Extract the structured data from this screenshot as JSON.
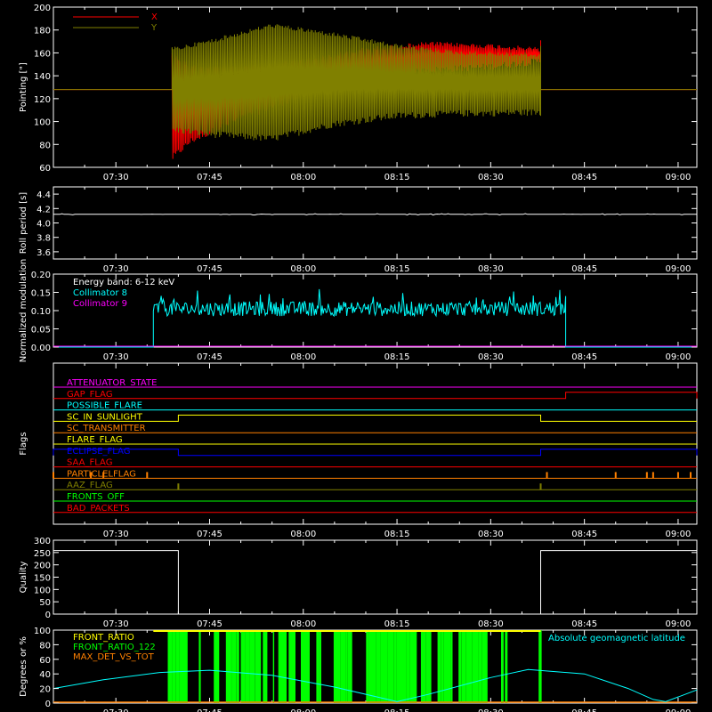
{
  "x_tick_labels": [
    "07:30",
    "07:45",
    "08:00",
    "08:15",
    "08:30",
    "08:45",
    "09:00"
  ],
  "chart_data": [
    {
      "type": "line",
      "ylabel": "Pointing [\"]",
      "ylim": [
        60,
        200
      ],
      "yticks": [
        "60",
        "80",
        "100",
        "120",
        "140",
        "160",
        "180",
        "200"
      ],
      "legend": [
        {
          "name": "X",
          "color": "#ff0000"
        },
        {
          "name": "Y",
          "color": "#808000"
        }
      ],
      "series": [
        {
          "name": "X",
          "color": "#ff0000",
          "baseline": 128,
          "active_start": "07:39",
          "active_end": "08:38",
          "envelope": [
            [
              "07:39",
              65,
              160
            ],
            [
              "07:42",
              80,
              150
            ],
            [
              "07:50",
              100,
              148
            ],
            [
              "08:00",
              120,
              155
            ],
            [
              "08:10",
              132,
              165
            ],
            [
              "08:20",
              142,
              170
            ],
            [
              "08:30",
              145,
              168
            ],
            [
              "08:38",
              150,
              165
            ]
          ]
        },
        {
          "name": "Y",
          "color": "#808000",
          "baseline": 128,
          "active_start": "07:39",
          "active_end": "08:38",
          "envelope": [
            [
              "07:39",
              90,
              165
            ],
            [
              "07:45",
              86,
              172
            ],
            [
              "07:55",
              82,
              186
            ],
            [
              "08:05",
              95,
              178
            ],
            [
              "08:15",
              102,
              168
            ],
            [
              "08:25",
              104,
              162
            ],
            [
              "08:38",
              105,
              160
            ]
          ]
        }
      ]
    },
    {
      "type": "line",
      "ylabel": "Roll period [s]",
      "ylim": [
        3.5,
        4.5
      ],
      "yticks": [
        "3.6",
        "3.8",
        "4.0",
        "4.2",
        "4.4"
      ],
      "series": [
        {
          "name": "roll",
          "color": "#ffffff",
          "value": 4.12
        }
      ]
    },
    {
      "type": "line",
      "ylabel": "Normalized modulation",
      "ylim": [
        0,
        0.2
      ],
      "yticks": [
        "0.00",
        "0.05",
        "0.10",
        "0.15",
        "0.20"
      ],
      "annotation": "Energy band: 6-12 keV",
      "legend": [
        {
          "name": "Collimator 8",
          "color": "#00ffff"
        },
        {
          "name": "Collimator 9",
          "color": "#ff00ff"
        }
      ],
      "series": [
        {
          "name": "Collimator 8",
          "color": "#00ffff",
          "active_start": "07:36",
          "active_end": "08:42",
          "mean": 0.105,
          "spread": 0.02
        },
        {
          "name": "Collimator 9",
          "color": "#ff00ff",
          "value": 0.0
        }
      ]
    },
    {
      "type": "line",
      "ylabel": "Flags",
      "flags": [
        {
          "name": "ATTENUATOR_STATE",
          "color": "#ff00ff",
          "on": []
        },
        {
          "name": "GAP_FLAG",
          "color": "#ff0000",
          "on": [
            [
              "08:42",
              "09:03"
            ]
          ]
        },
        {
          "name": "POSSIBLE_FLARE",
          "color": "#00ffff",
          "on": []
        },
        {
          "name": "SC_IN_SUNLIGHT",
          "color": "#ffff00",
          "on": [
            [
              "07:40",
              "08:38"
            ]
          ]
        },
        {
          "name": "SC_TRANSMITTER",
          "color": "#ff8000",
          "on": []
        },
        {
          "name": "FLARE_FLAG",
          "color": "#ffff00",
          "on": []
        },
        {
          "name": "ECLIPSE_FLAG",
          "color": "#0000ff",
          "on": [
            [
              "07:20",
              "07:40"
            ],
            [
              "08:38",
              "09:03"
            ]
          ]
        },
        {
          "name": "SAA_FLAG",
          "color": "#ff0000",
          "on": []
        },
        {
          "name": "PARTICLELFLAG",
          "color": "#ff8000",
          "spikes": [
            "07:20",
            "07:26",
            "07:28",
            "07:35",
            "08:39",
            "08:50",
            "08:55",
            "08:56",
            "09:00",
            "09:02"
          ]
        },
        {
          "name": "AAZ_FLAG",
          "color": "#808000",
          "spikes": [
            "07:40",
            "08:38"
          ]
        },
        {
          "name": "FRONTS_OFF",
          "color": "#00ff00",
          "on": []
        },
        {
          "name": "BAD_PACKETS",
          "color": "#ff0000",
          "on": []
        }
      ]
    },
    {
      "type": "line",
      "ylabel": "Quality",
      "ylim": [
        0,
        300
      ],
      "yticks": [
        "0",
        "50",
        "100",
        "150",
        "200",
        "250",
        "300"
      ],
      "series": [
        {
          "name": "quality",
          "color": "#ffffff",
          "points": [
            [
              "07:20",
              258
            ],
            [
              "07:40",
              258
            ],
            [
              "07:40",
              0
            ],
            [
              "08:38",
              0
            ],
            [
              "08:38",
              258
            ],
            [
              "09:03",
              258
            ]
          ]
        }
      ]
    },
    {
      "type": "line",
      "ylabel": "Degrees or %",
      "ylim": [
        0,
        100
      ],
      "yticks": [
        "0",
        "20",
        "40",
        "60",
        "80",
        "100"
      ],
      "legend": [
        {
          "name": "FRONT_RATIO",
          "color": "#ffff00"
        },
        {
          "name": "FRONT_RATIO_122",
          "color": "#00ff00"
        },
        {
          "name": "MAX_DET_VS_TOT",
          "color": "#ff8000"
        }
      ],
      "right_legend": {
        "name": "Absolute geomagnetic latitude",
        "color": "#00ffff"
      },
      "series": [
        {
          "name": "Absolute geomagnetic latitude",
          "color": "#00ffff",
          "points": [
            [
              "07:20",
              20
            ],
            [
              "07:28",
              32
            ],
            [
              "07:37",
              42
            ],
            [
              "07:45",
              45
            ],
            [
              "07:55",
              38
            ],
            [
              "08:05",
              22
            ],
            [
              "08:12",
              8
            ],
            [
              "08:15",
              2
            ],
            [
              "08:20",
              12
            ],
            [
              "08:30",
              35
            ],
            [
              "08:36",
              46
            ],
            [
              "08:45",
              40
            ],
            [
              "08:52",
              20
            ],
            [
              "08:56",
              5
            ],
            [
              "08:58",
              2
            ],
            [
              "09:03",
              18
            ]
          ]
        },
        {
          "name": "FRONT_RATIO_122",
          "color": "#00ff00",
          "active_start": "07:36",
          "active_end": "08:38",
          "value_range": [
            0,
            100
          ]
        },
        {
          "name": "FRONT_RATIO",
          "color": "#ffff00",
          "value": 100
        },
        {
          "name": "MAX_DET_VS_TOT",
          "color": "#ff8000",
          "value": 0
        }
      ]
    }
  ]
}
